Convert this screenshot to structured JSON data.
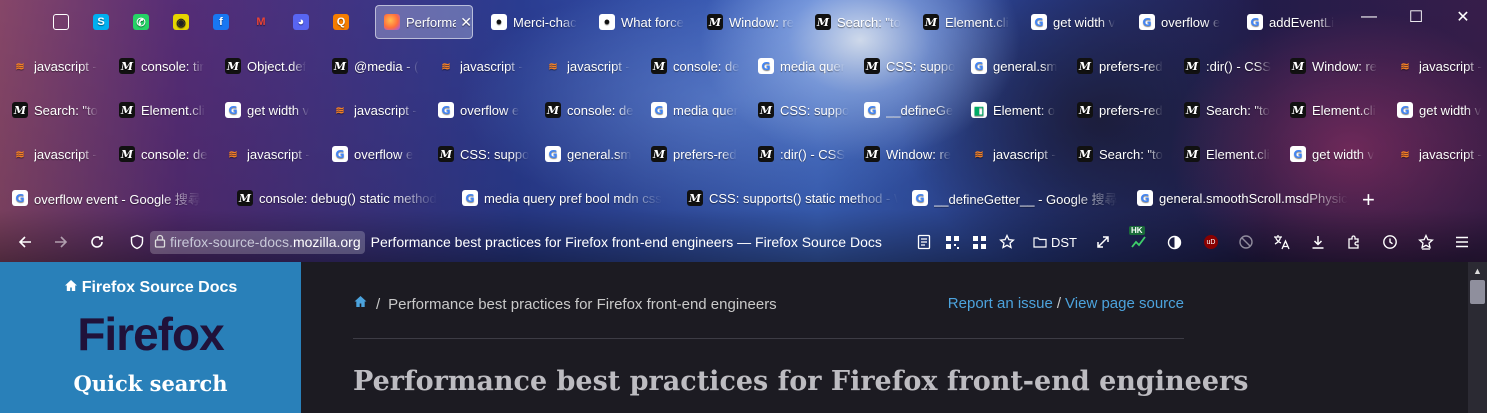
{
  "browser": {
    "pinned_tabs": [
      {
        "icon": "web-icon"
      },
      {
        "icon": "skype-icon"
      },
      {
        "icon": "whatsapp-icon"
      },
      {
        "icon": "app-icon"
      },
      {
        "icon": "facebook-icon"
      },
      {
        "icon": "gmail-icon"
      },
      {
        "icon": "discord-icon"
      },
      {
        "icon": "search-app-icon"
      }
    ],
    "tab_rows": [
      [
        {
          "title": "Performa",
          "icon": "firefox-icon",
          "active": true
        },
        {
          "title": "Merci-chac",
          "icon": "github-icon"
        },
        {
          "title": "What force",
          "icon": "github-icon"
        },
        {
          "title": "Window: re",
          "icon": "mdn-icon"
        },
        {
          "title": "Search: \"to",
          "icon": "mdn-icon"
        },
        {
          "title": "Element.cli",
          "icon": "mdn-icon"
        },
        {
          "title": "get width v",
          "icon": "google-icon"
        },
        {
          "title": "overflow e",
          "icon": "google-icon"
        },
        {
          "title": "addEventLi",
          "icon": "google-icon"
        }
      ],
      [
        {
          "title": "javascript -",
          "icon": "stackoverflow-icon"
        },
        {
          "title": "console: tir",
          "icon": "mdn-icon"
        },
        {
          "title": "Object.def",
          "icon": "mdn-icon"
        },
        {
          "title": "@media - (",
          "icon": "mdn-icon"
        },
        {
          "title": "javascript -",
          "icon": "stackoverflow-icon"
        },
        {
          "title": "javascript -",
          "icon": "stackoverflow-icon"
        },
        {
          "title": "console: de",
          "icon": "mdn-icon"
        },
        {
          "title": "media quer",
          "icon": "google-icon"
        },
        {
          "title": "CSS: suppo",
          "icon": "mdn-icon"
        },
        {
          "title": "general.sm",
          "icon": "google-icon"
        },
        {
          "title": "prefers-red",
          "icon": "mdn-icon"
        },
        {
          "title": ":dir() - CSS",
          "icon": "mdn-icon"
        },
        {
          "title": "Window: re",
          "icon": "mdn-icon"
        },
        {
          "title": "javascript -",
          "icon": "stackoverflow-icon"
        }
      ],
      [
        {
          "title": "Search: \"to",
          "icon": "mdn-icon"
        },
        {
          "title": "Element.cli",
          "icon": "mdn-icon"
        },
        {
          "title": "get width v",
          "icon": "google-icon"
        },
        {
          "title": "javascript -",
          "icon": "stackoverflow-icon"
        },
        {
          "title": "overflow e",
          "icon": "google-icon"
        },
        {
          "title": "console: de",
          "icon": "mdn-icon"
        },
        {
          "title": "media quer",
          "icon": "google-icon"
        },
        {
          "title": "CSS: suppo",
          "icon": "mdn-icon"
        },
        {
          "title": "__defineGe",
          "icon": "google-icon"
        },
        {
          "title": "Element: o",
          "icon": "element-icon"
        },
        {
          "title": "prefers-red",
          "icon": "mdn-icon"
        },
        {
          "title": "Search: \"to",
          "icon": "mdn-icon"
        },
        {
          "title": "Element.cli",
          "icon": "mdn-icon"
        },
        {
          "title": "get width v",
          "icon": "google-icon"
        }
      ],
      [
        {
          "title": "javascript -",
          "icon": "stackoverflow-icon"
        },
        {
          "title": "console: de",
          "icon": "mdn-icon"
        },
        {
          "title": "javascript -",
          "icon": "stackoverflow-icon"
        },
        {
          "title": "overflow e",
          "icon": "google-icon"
        },
        {
          "title": "CSS: suppo",
          "icon": "mdn-icon"
        },
        {
          "title": "general.sm",
          "icon": "google-icon"
        },
        {
          "title": "prefers-red",
          "icon": "mdn-icon"
        },
        {
          "title": ":dir() - CSS",
          "icon": "mdn-icon"
        },
        {
          "title": "Window: re",
          "icon": "mdn-icon"
        },
        {
          "title": "javascript -",
          "icon": "stackoverflow-icon"
        },
        {
          "title": "Search: \"to",
          "icon": "mdn-icon"
        },
        {
          "title": "Element.cli",
          "icon": "mdn-icon"
        },
        {
          "title": "get width v",
          "icon": "google-icon"
        },
        {
          "title": "javascript -",
          "icon": "stackoverflow-icon"
        }
      ],
      [
        {
          "title": "overflow event - Google 搜尋",
          "icon": "google-icon"
        },
        {
          "title": "console: debug() static method",
          "icon": "mdn-icon"
        },
        {
          "title": "media query pref bool mdn css",
          "icon": "google-icon"
        },
        {
          "title": "CSS: supports() static method - W",
          "icon": "mdn-icon"
        },
        {
          "title": "__defineGetter__ - Google 搜尋",
          "icon": "google-icon"
        },
        {
          "title": "general.smoothScroll.msdPhysic",
          "icon": "google-icon"
        }
      ]
    ],
    "new_tab_label": "+",
    "window_controls": {
      "minimize": "—",
      "maximize": "☐",
      "close": "✕"
    },
    "url": {
      "subdomain": "firefox-source-docs.",
      "domain": "mozilla.org",
      "page_title": "Performance best practices for Firefox front-end engineers — Firefox Source Docs"
    },
    "bookmark_folder": "DST",
    "extension_badge": "HK",
    "ublock_label": "uD"
  },
  "page": {
    "sidebar": {
      "home_link": "Firefox Source Docs",
      "logo_text": "Firefox",
      "quick_search": "Quick search"
    },
    "breadcrumb": {
      "separator": "/",
      "current": "Performance best practices for Firefox front-end engineers",
      "report_issue": "Report an issue",
      "link_separator": "/",
      "view_source": "View page source"
    },
    "title": "Performance best practices for Firefox front-end engineers"
  },
  "colors": {
    "sidebar_bg": "#2980b9",
    "link": "#4ca3dd",
    "page_bg": "#1c1b22"
  }
}
